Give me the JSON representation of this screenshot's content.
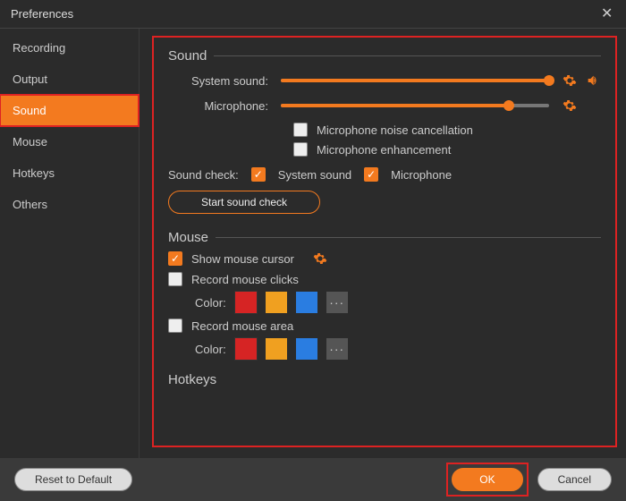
{
  "window": {
    "title": "Preferences"
  },
  "sidebar": {
    "items": [
      {
        "label": "Recording"
      },
      {
        "label": "Output"
      },
      {
        "label": "Sound",
        "active": true
      },
      {
        "label": "Mouse"
      },
      {
        "label": "Hotkeys"
      },
      {
        "label": "Others"
      }
    ]
  },
  "sound": {
    "title": "Sound",
    "system_label": "System sound:",
    "system_percent": 100,
    "mic_label": "Microphone:",
    "mic_percent": 85,
    "noise_cancel": {
      "checked": false,
      "label": "Microphone noise cancellation"
    },
    "enhancement": {
      "checked": false,
      "label": "Microphone enhancement"
    },
    "check_label": "Sound check:",
    "check_system": {
      "checked": true,
      "label": "System sound"
    },
    "check_mic": {
      "checked": true,
      "label": "Microphone"
    },
    "start_btn": "Start sound check"
  },
  "mouse": {
    "title": "Mouse",
    "show_cursor": {
      "checked": true,
      "label": "Show mouse cursor"
    },
    "record_clicks": {
      "checked": false,
      "label": "Record mouse clicks"
    },
    "record_area": {
      "checked": false,
      "label": "Record mouse area"
    },
    "color_label": "Color:",
    "swatches": [
      "#d62424",
      "#f0a020",
      "#2a7de1"
    ],
    "more": "···"
  },
  "hotkeys": {
    "title": "Hotkeys"
  },
  "footer": {
    "reset": "Reset to Default",
    "ok": "OK",
    "cancel": "Cancel"
  }
}
